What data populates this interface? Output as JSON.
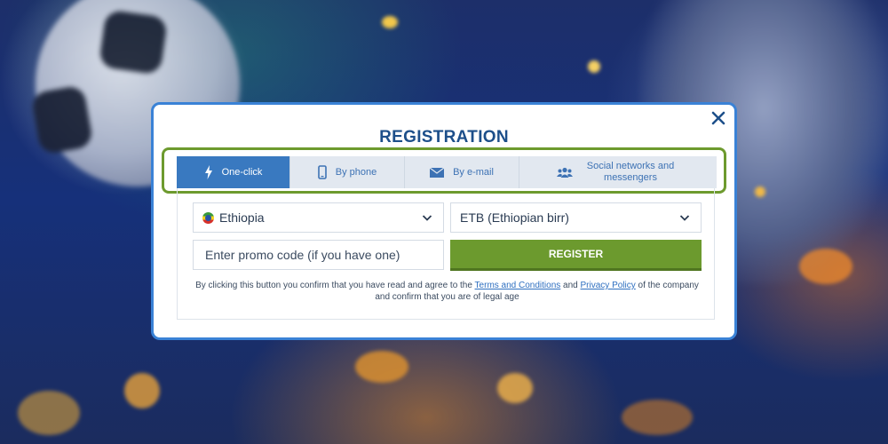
{
  "modal": {
    "title": "REGISTRATION",
    "close_icon": "close-icon"
  },
  "tabs": [
    {
      "label": "One-click",
      "icon": "lightning-icon",
      "active": true
    },
    {
      "label": "By phone",
      "icon": "phone-icon",
      "active": false
    },
    {
      "label": "By e-mail",
      "icon": "envelope-icon",
      "active": false
    },
    {
      "label": "Social networks and messengers",
      "icon": "people-icon",
      "active": false
    }
  ],
  "form": {
    "country": {
      "value": "Ethiopia",
      "icon": "ethiopia-flag-icon"
    },
    "currency": {
      "value": "ETB (Ethiopian birr)"
    },
    "promo": {
      "placeholder": "Enter promo code (if you have one)"
    },
    "register_label": "REGISTER"
  },
  "disclaimer": {
    "part1": "By clicking this button you confirm that you have read and agree to the",
    "terms_link": "Terms and Conditions",
    "part2": "and",
    "privacy_link": "Privacy Policy",
    "part3": "of the company and confirm that you are of legal age"
  },
  "colors": {
    "accent": "#3979c0",
    "register": "#6c9a2e",
    "highlight": "#6d9a2e",
    "title": "#1d4f8a"
  }
}
